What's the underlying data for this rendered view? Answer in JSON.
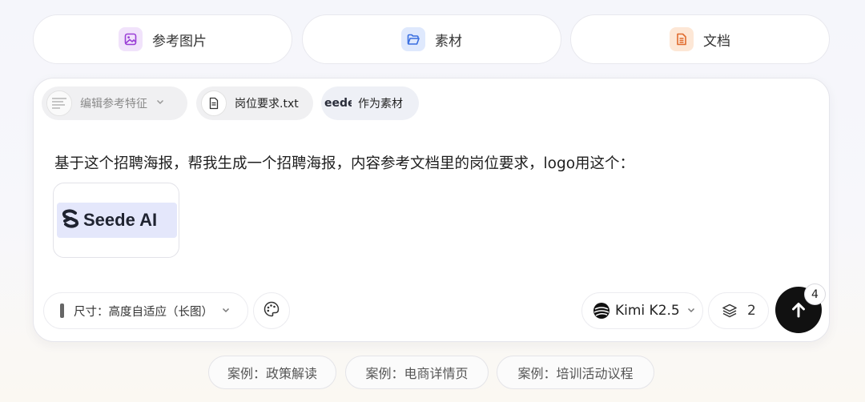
{
  "top_tabs": [
    {
      "label": "参考图片",
      "icon": "image-icon",
      "color": "#9a3fd6",
      "bg": "#f1e3fb"
    },
    {
      "label": "素材",
      "icon": "folder-icon",
      "color": "#3a6fe0",
      "bg": "#dfe9fd"
    },
    {
      "label": "文档",
      "icon": "document-icon",
      "color": "#e06b2e",
      "bg": "#fde7d6"
    }
  ],
  "attachments": {
    "ref_chip": {
      "label": "编辑参考特征",
      "icon": "chevron-down-icon"
    },
    "doc_chip": {
      "label": "岗位要求.txt",
      "icon": "file-icon"
    },
    "material_chip": {
      "thumb_text": "eede",
      "label": "作为素材"
    }
  },
  "prompt": {
    "text": "基于这个招聘海报，帮我生成一个招聘海报，内容参考文档里的岗位要求，logo用这个："
  },
  "logo_attachment": {
    "text": "Seede AI"
  },
  "toolbar": {
    "size_label": "尺寸：高度自适应（长图）",
    "model_label": "Kimi K2.5",
    "layers_count": "2",
    "send_badge": "4"
  },
  "examples": [
    {
      "label": "案例：政策解读"
    },
    {
      "label": "案例：电商详情页"
    },
    {
      "label": "案例：培训活动议程"
    }
  ],
  "colors": {
    "accent_send": "#111111",
    "card_bg": "#ffffff"
  }
}
